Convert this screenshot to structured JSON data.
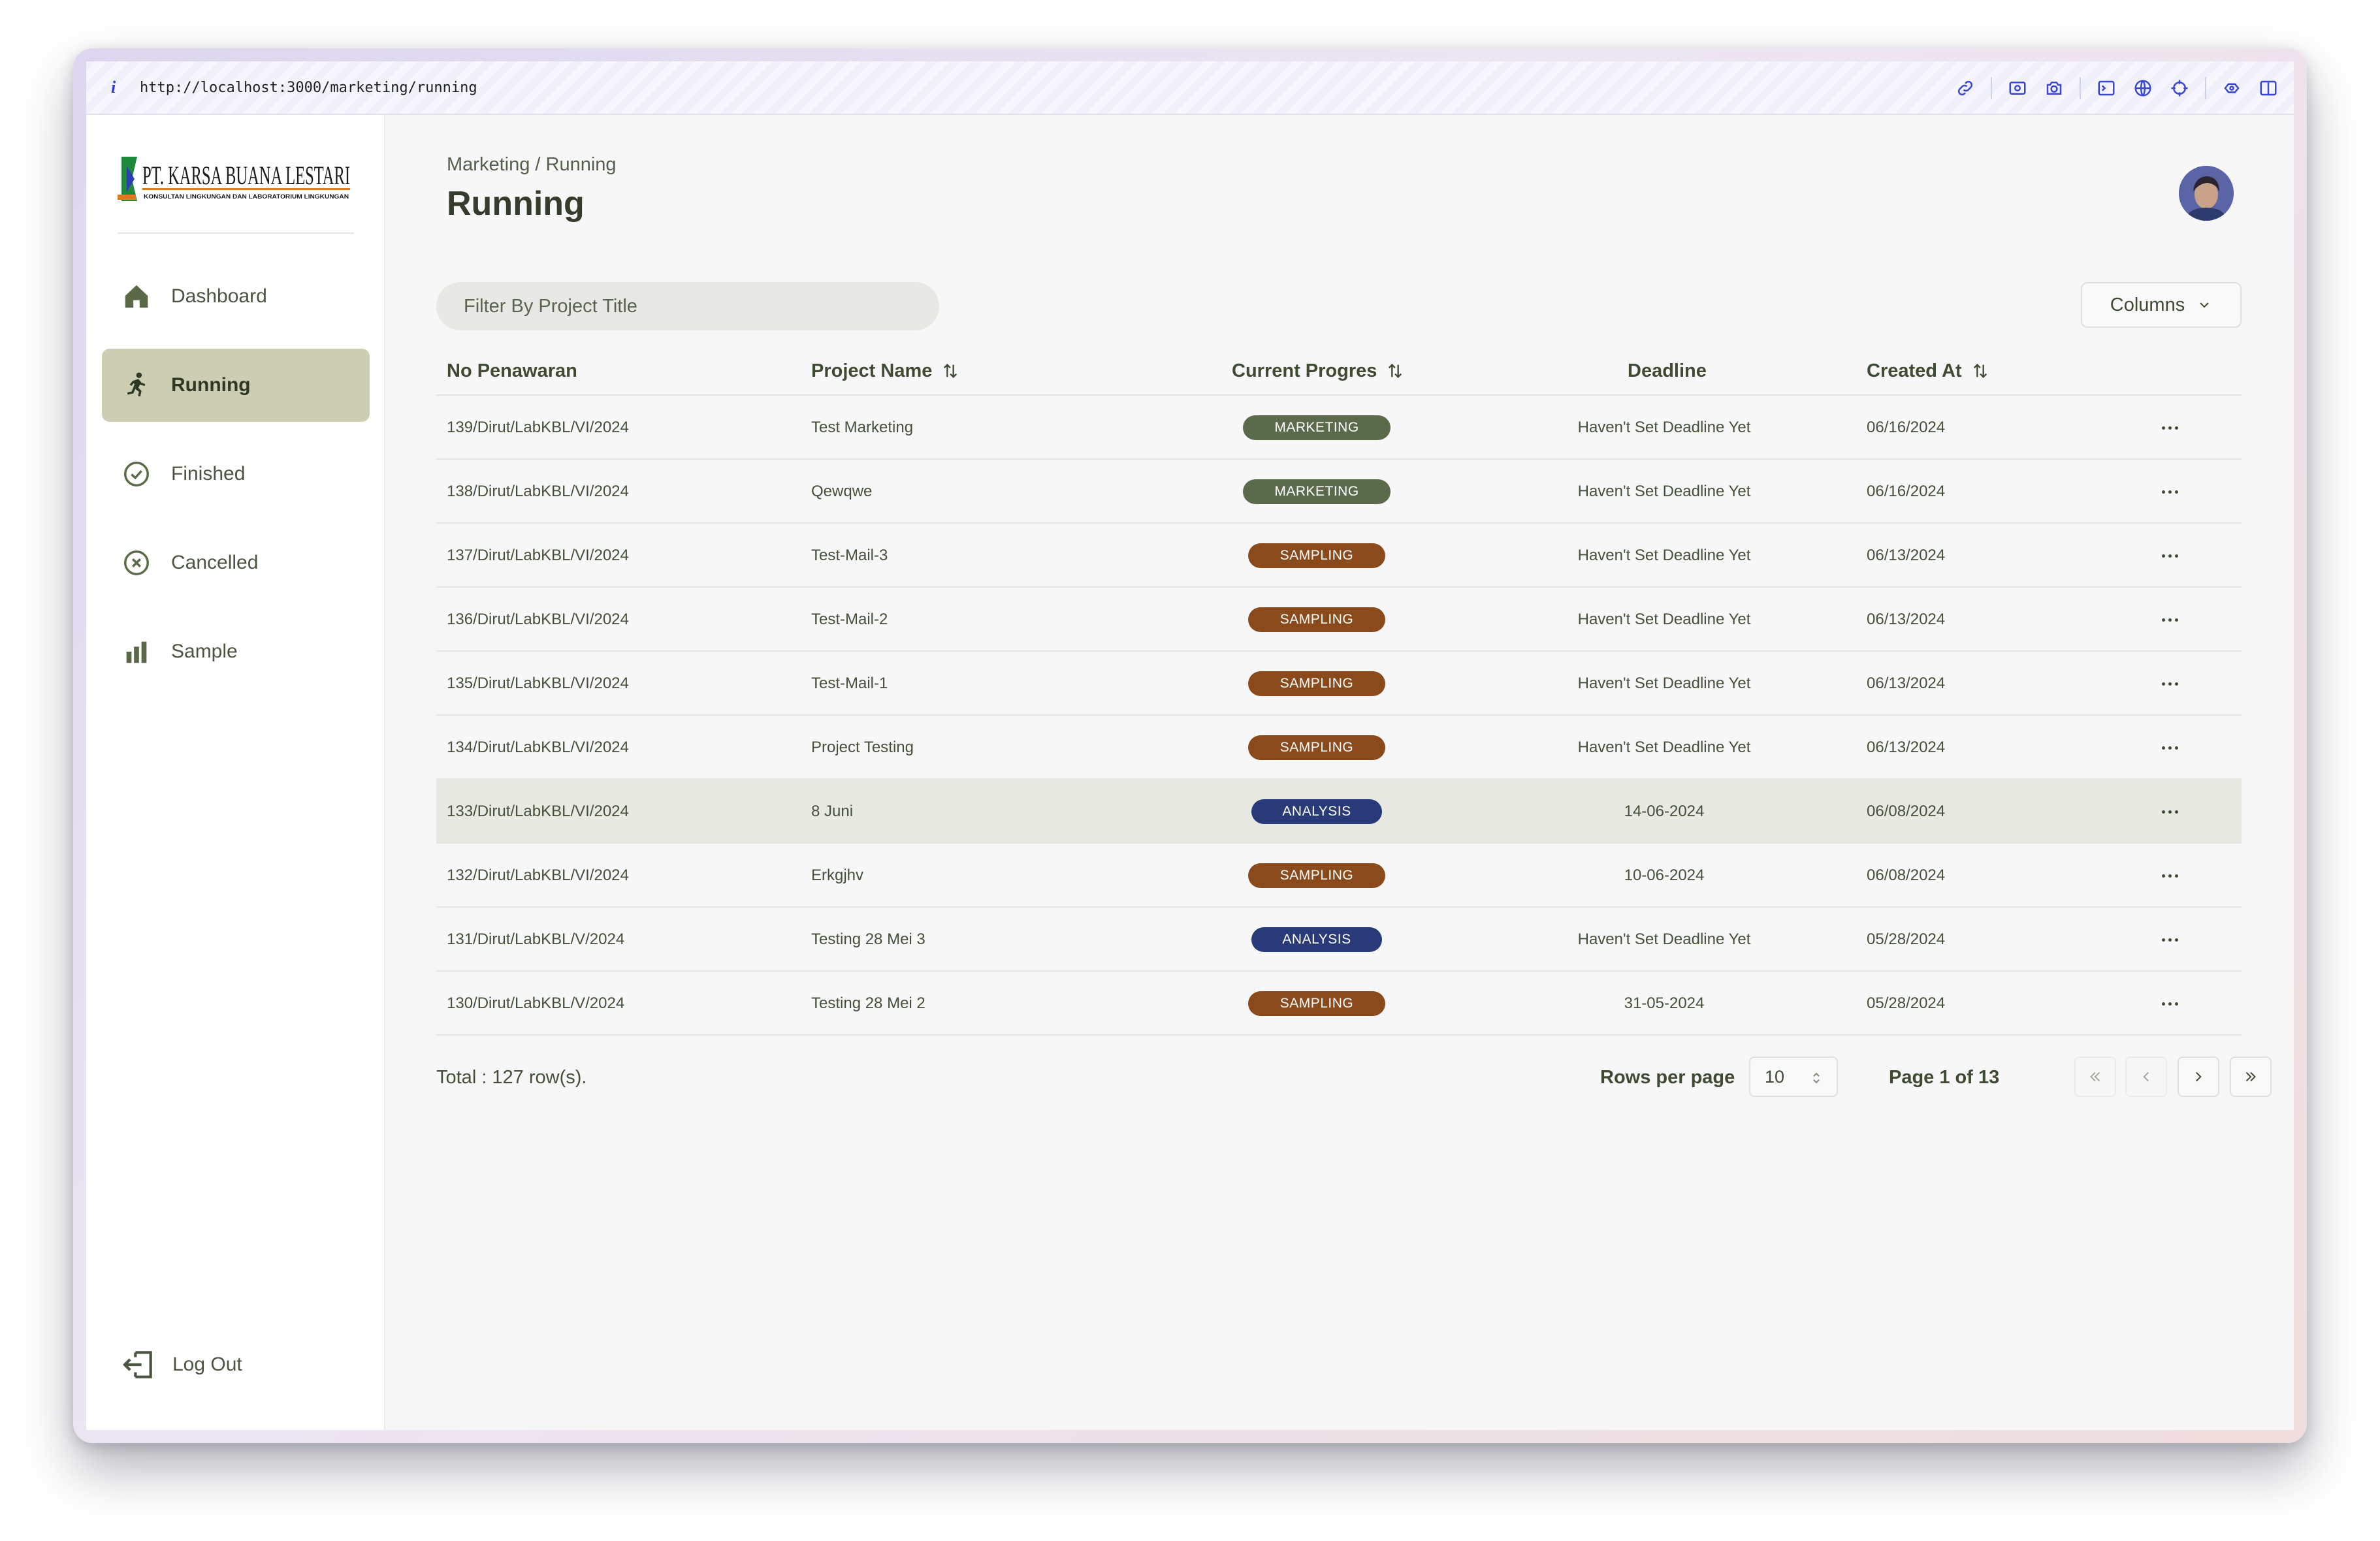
{
  "browser": {
    "url": "http://localhost:3000/marketing/running",
    "info_icon": "i"
  },
  "logo": {
    "company": "PT. KARSA BUANA LESTARI",
    "tagline": "KONSULTAN LINGKUNGAN DAN LABORATORIUM LINGKUNGAN"
  },
  "sidebar": {
    "items": [
      {
        "label": "Dashboard",
        "icon": "home-icon"
      },
      {
        "label": "Running",
        "icon": "running-person-icon",
        "active": true
      },
      {
        "label": "Finished",
        "icon": "check-circle-icon"
      },
      {
        "label": "Cancelled",
        "icon": "x-circle-icon"
      },
      {
        "label": "Sample",
        "icon": "bar-chart-icon"
      }
    ],
    "logout": "Log Out"
  },
  "header": {
    "breadcrumb": "Marketing / Running",
    "title": "Running"
  },
  "filter": {
    "placeholder": "Filter By Project Title",
    "value": ""
  },
  "columns_button": "Columns",
  "table": {
    "headers": {
      "no_penawaran": "No Penawaran",
      "project_name": "Project Name",
      "current_progress": "Current Progres",
      "deadline": "Deadline",
      "created_at": "Created At"
    },
    "rows": [
      {
        "no": "139/Dirut/LabKBL/VI/2024",
        "name": "Test Marketing",
        "progress": "MARKETING",
        "deadline": "Haven't Set Deadline Yet",
        "created": "06/16/2024"
      },
      {
        "no": "138/Dirut/LabKBL/VI/2024",
        "name": "Qewqwe",
        "progress": "MARKETING",
        "deadline": "Haven't Set Deadline Yet",
        "created": "06/16/2024"
      },
      {
        "no": "137/Dirut/LabKBL/VI/2024",
        "name": "Test-Mail-3",
        "progress": "SAMPLING",
        "deadline": "Haven't Set Deadline Yet",
        "created": "06/13/2024"
      },
      {
        "no": "136/Dirut/LabKBL/VI/2024",
        "name": "Test-Mail-2",
        "progress": "SAMPLING",
        "deadline": "Haven't Set Deadline Yet",
        "created": "06/13/2024"
      },
      {
        "no": "135/Dirut/LabKBL/VI/2024",
        "name": "Test-Mail-1",
        "progress": "SAMPLING",
        "deadline": "Haven't Set Deadline Yet",
        "created": "06/13/2024"
      },
      {
        "no": "134/Dirut/LabKBL/VI/2024",
        "name": "Project Testing",
        "progress": "SAMPLING",
        "deadline": "Haven't Set Deadline Yet",
        "created": "06/13/2024"
      },
      {
        "no": "133/Dirut/LabKBL/VI/2024",
        "name": "8 Juni",
        "progress": "ANALYSIS",
        "deadline": "14-06-2024",
        "created": "06/08/2024"
      },
      {
        "no": "132/Dirut/LabKBL/VI/2024",
        "name": "Erkgjhv",
        "progress": "SAMPLING",
        "deadline": "10-06-2024",
        "created": "06/08/2024"
      },
      {
        "no": "131/Dirut/LabKBL/V/2024",
        "name": "Testing 28 Mei 3",
        "progress": "ANALYSIS",
        "deadline": "Haven't Set Deadline Yet",
        "created": "05/28/2024"
      },
      {
        "no": "130/Dirut/LabKBL/V/2024",
        "name": "Testing 28 Mei 2",
        "progress": "SAMPLING",
        "deadline": "31-05-2024",
        "created": "05/28/2024"
      }
    ]
  },
  "badge_colors": {
    "MARKETING": "#5c6a4c",
    "SAMPLING": "#8a4a1c",
    "ANALYSIS": "#283a78"
  },
  "footer": {
    "total": "Total : 127 row(s).",
    "rows_per_page_label": "Rows per page",
    "rows_per_page_value": "10",
    "page_info": "Page 1 of 13"
  }
}
